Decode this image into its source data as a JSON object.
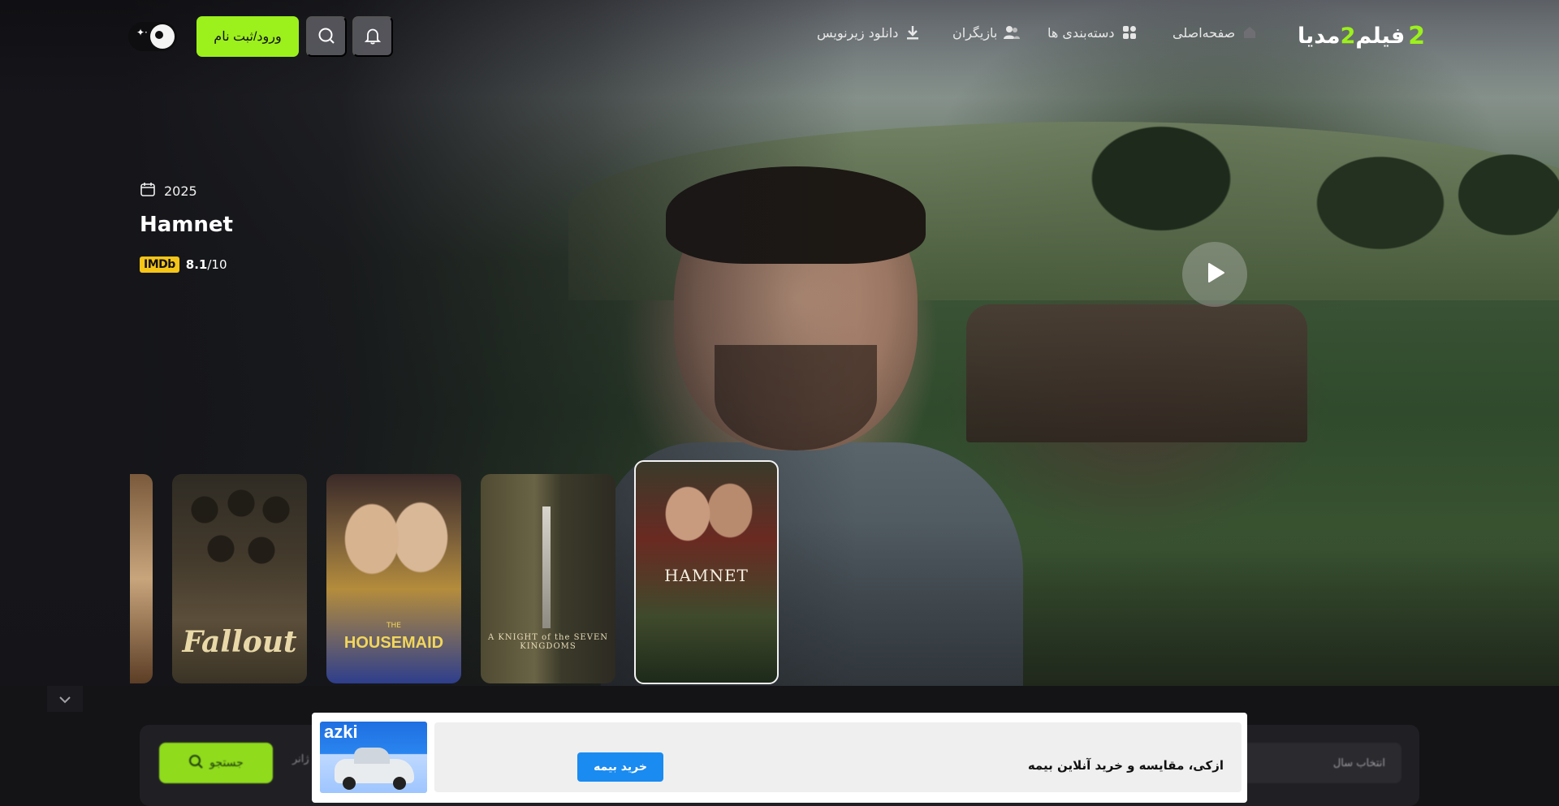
{
  "nav": {
    "logo_text": "فیلم",
    "logo_accent": "2",
    "logo_text2": "مدیا",
    "logo_mark": "2",
    "items": [
      {
        "label": "صفحه‌اصلی",
        "icon": "home-icon"
      },
      {
        "label": "دسته‌بندی ها",
        "icon": "grid-icon"
      },
      {
        "label": "بازیگران",
        "icon": "users-icon"
      },
      {
        "label": "دانلود زیرنویس",
        "icon": "download-icon"
      }
    ],
    "login_label": "ورود/ثبت نام",
    "search_icon": "search-icon",
    "bell_icon": "bell-icon",
    "theme_icon": "moon-icon"
  },
  "hero": {
    "year": "2025",
    "title": "Hamnet",
    "imdb_label": "IMDb",
    "rating": "8.1",
    "rating_max": "/10"
  },
  "posters": [
    {
      "title": "Fallout"
    },
    {
      "pre": "THE",
      "title": "HOUSEMAID"
    },
    {
      "title": "A KNIGHT of the SEVEN KINGDOMS"
    },
    {
      "title": "HAMNET"
    }
  ],
  "lower": {
    "green_button": "جستجو",
    "field_hint": "انتخاب سال",
    "mid_label": "ژانر"
  },
  "ad": {
    "brand": "azki",
    "cta": "خرید بیمه",
    "title": "ازکی، مقایسه و خرید آنلاین بیمه"
  },
  "colors": {
    "accent": "#9cf01c",
    "background": "#141417",
    "imdb": "#f5c518",
    "ad_cta": "#1a8bf0"
  }
}
